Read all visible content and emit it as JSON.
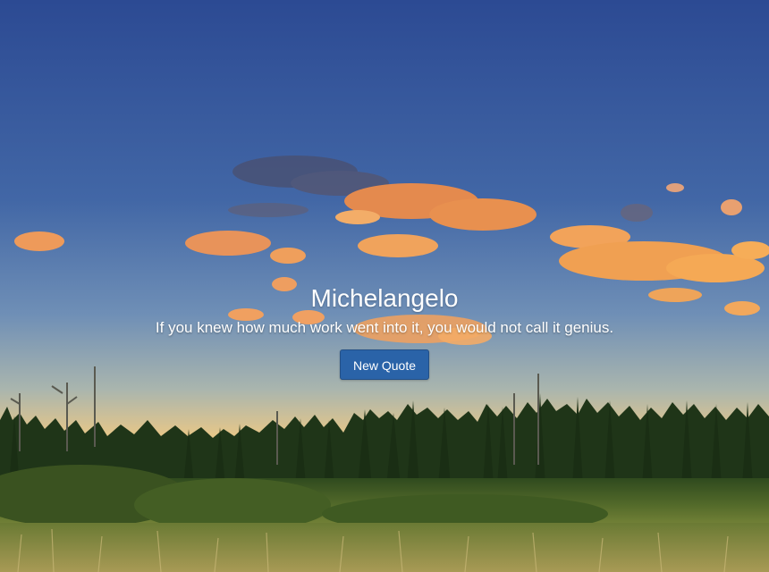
{
  "quote": {
    "author": "Michelangelo",
    "text": "If you knew how much work went into it, you would not call it genius."
  },
  "actions": {
    "new_quote_label": "New Quote"
  },
  "colors": {
    "sky_top": "#2f4c94",
    "sky_middle": "#5d7fb0",
    "sky_horizon": "#e7c98a",
    "clouds": "#f0a35a",
    "button": "#2a63a8",
    "text": "#ffffff"
  }
}
